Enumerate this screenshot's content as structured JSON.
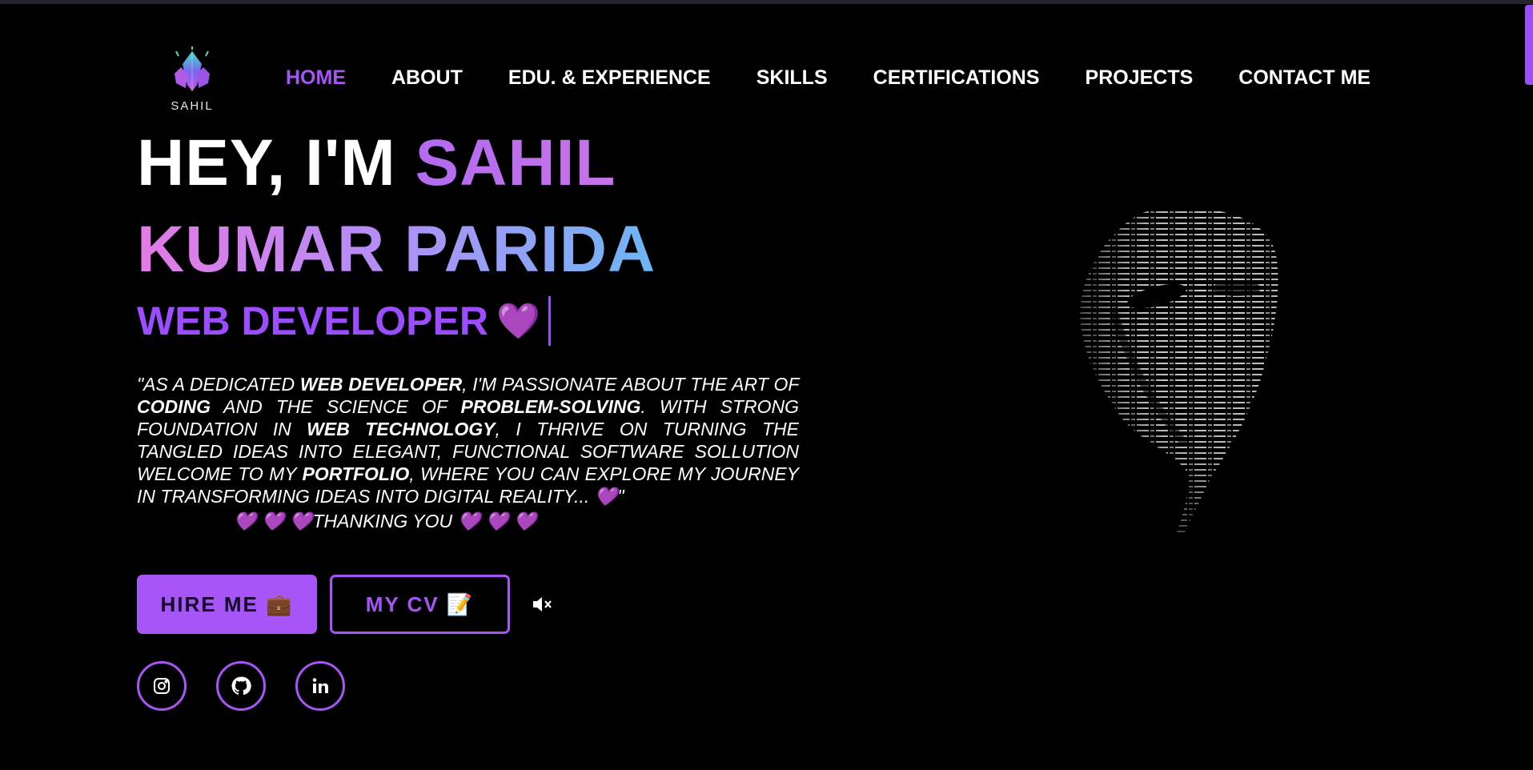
{
  "brand": {
    "logo_text": "SAHIL"
  },
  "nav": {
    "items": [
      {
        "label": "HOME",
        "active": true
      },
      {
        "label": "ABOUT"
      },
      {
        "label": "EDU. & EXPERIENCE"
      },
      {
        "label": "SKILLS"
      },
      {
        "label": "CERTIFICATIONS"
      },
      {
        "label": "PROJECTS"
      },
      {
        "label": "CONTACT ME"
      }
    ]
  },
  "hero": {
    "greeting": "HEY, I'M ",
    "name_line1": "SAHIL",
    "name_line2": "KUMAR PARIDA",
    "role": "WEB DEVELOPER",
    "role_heart": "💜",
    "description": {
      "p1": "\"AS A DEDICATED ",
      "b1": "WEB DEVELOPER",
      "p2": ", I'M PASSIONATE ABOUT THE ART OF ",
      "b2": "CODING",
      "p3": " AND THE SCIENCE OF ",
      "b3": "PROBLEM-SOLVING",
      "p4": ". WITH STRONG FOUNDATION IN ",
      "b4": "WEB TECHNOLOGY",
      "p5": ", I THRIVE ON TURNING THE TANGLED IDEAS INTO ELEGANT, FUNCTIONAL SOFTWARE SOLLUTION WELCOME TO MY ",
      "b5": "PORTFOLIO",
      "p6": ", WHERE YOU CAN EXPLORE MY JOURNEY IN TRANSFORMING IDEAS INTO DIGITAL REALITY... 💜\"",
      "thanks": "💜 💜 💜THANKING YOU 💜 💜 💜"
    }
  },
  "buttons": {
    "hire": "HIRE ME 💼",
    "cv": "MY CV 📝",
    "mute_icon": "🔇"
  },
  "socials": [
    {
      "icon": "instagram-icon"
    },
    {
      "icon": "github-icon"
    },
    {
      "icon": "linkedin-icon"
    }
  ],
  "colors": {
    "accent": "#a855f7",
    "background": "#000000",
    "text": "#ffffff"
  }
}
